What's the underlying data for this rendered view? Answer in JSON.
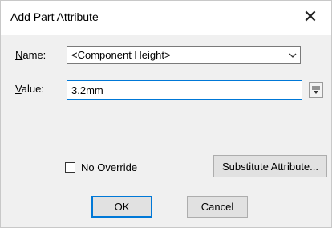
{
  "window": {
    "title": "Add Part Attribute"
  },
  "fields": {
    "name_label": "Name:",
    "name_value": "<Component Height>",
    "value_label": "Value:",
    "value_value": "3.2mm"
  },
  "checkbox": {
    "label": "No Override",
    "checked": false
  },
  "buttons": {
    "substitute": "Substitute Attribute...",
    "ok": "OK",
    "cancel": "Cancel"
  },
  "colors": {
    "accent": "#0078d7"
  }
}
